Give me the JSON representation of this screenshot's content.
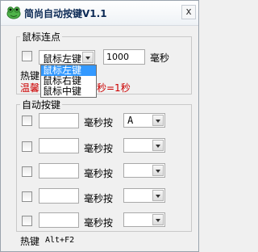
{
  "window": {
    "title": "简尚自动按键V1.1",
    "close_label": "x"
  },
  "mouse_section": {
    "label": "鼠标连点",
    "button_select": "鼠标左键",
    "interval_value": "1000",
    "interval_unit": "毫秒",
    "dropdown_options": [
      "鼠标左键",
      "鼠标右键",
      "鼠标中键"
    ],
    "hotkey_label": "热键",
    "tip_prefix": "温馨",
    "tip_suffix": "秒=1秒"
  },
  "auto_section": {
    "label": "自动按键",
    "rows": [
      {
        "unit": "毫秒按",
        "key": "A"
      },
      {
        "unit": "毫秒按",
        "key": ""
      },
      {
        "unit": "毫秒按",
        "key": ""
      },
      {
        "unit": "毫秒按",
        "key": ""
      },
      {
        "unit": "毫秒按",
        "key": ""
      }
    ]
  },
  "footer": {
    "hotkey_label": "热键",
    "hotkey_value": "Alt+F2"
  },
  "colors": {
    "tip_text": "#cc0000",
    "selection": "#3399ff"
  }
}
